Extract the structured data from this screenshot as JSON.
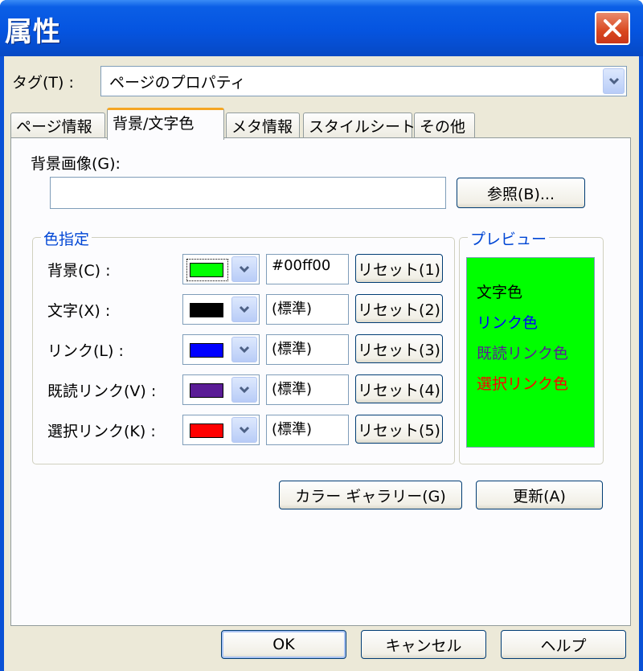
{
  "window": {
    "title": "属性",
    "close_icon": "close-icon"
  },
  "tag": {
    "label": "タグ(T) :",
    "value": "ページのプロパティ"
  },
  "tabs": [
    {
      "label": "ページ情報",
      "active": false
    },
    {
      "label": "背景/文字色",
      "active": true
    },
    {
      "label": "メタ情報",
      "active": false
    },
    {
      "label": "スタイルシート",
      "active": false
    },
    {
      "label": "その他",
      "active": false
    }
  ],
  "background_image": {
    "label": "背景画像(G):",
    "value": "",
    "browse_button": "参照(B)..."
  },
  "color_group": {
    "title": "色指定",
    "rows": [
      {
        "label": "背景(C) :",
        "color": "#00ff00",
        "value": "#00ff00",
        "reset": "リセット(1)"
      },
      {
        "label": "文字(X) :",
        "color": "#000000",
        "value": "(標準)",
        "reset": "リセット(2)"
      },
      {
        "label": "リンク(L) :",
        "color": "#0000ff",
        "value": "(標準)",
        "reset": "リセット(3)"
      },
      {
        "label": "既読リンク(V) :",
        "color": "#5a1c96",
        "value": "(標準)",
        "reset": "リセット(4)"
      },
      {
        "label": "選択リンク(K) :",
        "color": "#ff0000",
        "value": "(標準)",
        "reset": "リセット(5)"
      }
    ]
  },
  "preview": {
    "title": "プレビュー",
    "background": "#00ff00",
    "lines": [
      {
        "text": "文字色",
        "color": "#000000"
      },
      {
        "text": "リンク色",
        "color": "#0000ff"
      },
      {
        "text": "既読リンク色",
        "color": "#5a1c96"
      },
      {
        "text": "選択リンク色",
        "color": "#ff0000"
      }
    ]
  },
  "actions": {
    "gallery_button": "カラー ギャラリー(G)",
    "update_button": "更新(A)"
  },
  "footer": {
    "ok_button": "OK",
    "cancel_button": "キャンセル",
    "help_button": "ヘルプ"
  }
}
